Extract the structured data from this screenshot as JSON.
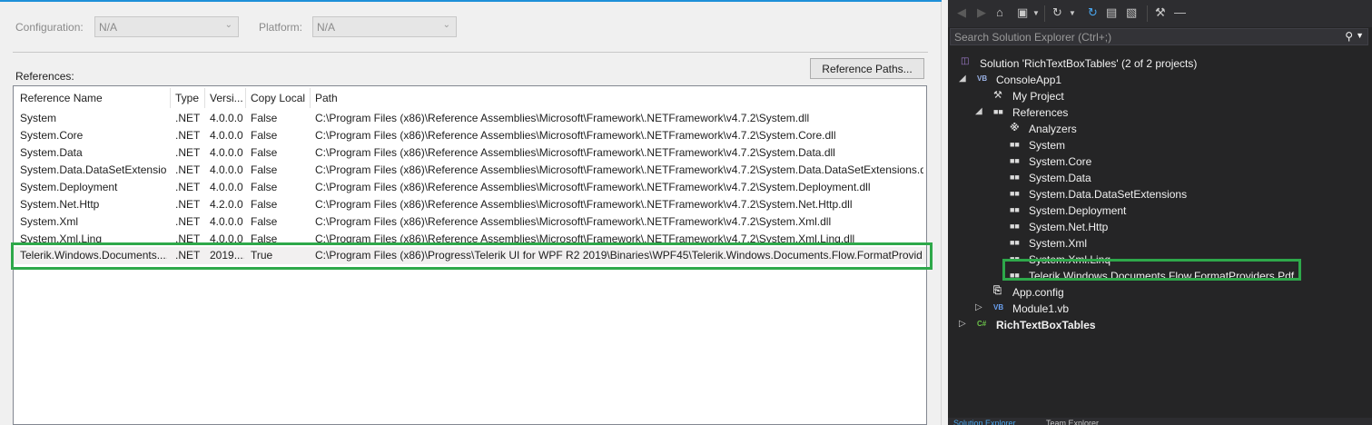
{
  "config": {
    "configuration_label": "Configuration:",
    "configuration_value": "N/A",
    "platform_label": "Platform:",
    "platform_value": "N/A"
  },
  "references": {
    "label": "References:",
    "paths_button": "Reference Paths...",
    "columns": [
      "Reference Name",
      "Type",
      "Versi...",
      "Copy Local",
      "Path"
    ],
    "rows": [
      {
        "name": "System",
        "type": ".NET",
        "version": "4.0.0.0",
        "copy_local": "False",
        "path": "C:\\Program Files (x86)\\Reference Assemblies\\Microsoft\\Framework\\.NETFramework\\v4.7.2\\System.dll"
      },
      {
        "name": "System.Core",
        "type": ".NET",
        "version": "4.0.0.0",
        "copy_local": "False",
        "path": "C:\\Program Files (x86)\\Reference Assemblies\\Microsoft\\Framework\\.NETFramework\\v4.7.2\\System.Core.dll"
      },
      {
        "name": "System.Data",
        "type": ".NET",
        "version": "4.0.0.0",
        "copy_local": "False",
        "path": "C:\\Program Files (x86)\\Reference Assemblies\\Microsoft\\Framework\\.NETFramework\\v4.7.2\\System.Data.dll"
      },
      {
        "name": "System.Data.DataSetExtensions",
        "type": ".NET",
        "version": "4.0.0.0",
        "copy_local": "False",
        "path": "C:\\Program Files (x86)\\Reference Assemblies\\Microsoft\\Framework\\.NETFramework\\v4.7.2\\System.Data.DataSetExtensions.dll"
      },
      {
        "name": "System.Deployment",
        "type": ".NET",
        "version": "4.0.0.0",
        "copy_local": "False",
        "path": "C:\\Program Files (x86)\\Reference Assemblies\\Microsoft\\Framework\\.NETFramework\\v4.7.2\\System.Deployment.dll"
      },
      {
        "name": "System.Net.Http",
        "type": ".NET",
        "version": "4.2.0.0",
        "copy_local": "False",
        "path": "C:\\Program Files (x86)\\Reference Assemblies\\Microsoft\\Framework\\.NETFramework\\v4.7.2\\System.Net.Http.dll"
      },
      {
        "name": "System.Xml",
        "type": ".NET",
        "version": "4.0.0.0",
        "copy_local": "False",
        "path": "C:\\Program Files (x86)\\Reference Assemblies\\Microsoft\\Framework\\.NETFramework\\v4.7.2\\System.Xml.dll"
      },
      {
        "name": "System.Xml.Linq",
        "type": ".NET",
        "version": "4.0.0.0",
        "copy_local": "False",
        "path": "C:\\Program Files (x86)\\Reference Assemblies\\Microsoft\\Framework\\.NETFramework\\v4.7.2\\System.Xml.Linq.dll"
      },
      {
        "name": "Telerik.Windows.Documents....",
        "type": ".NET",
        "version": "2019....",
        "copy_local": "True",
        "path": "C:\\Program Files (x86)\\Progress\\Telerik UI for WPF R2 2019\\Binaries\\WPF45\\Telerik.Windows.Documents.Flow.FormatProvid..."
      }
    ]
  },
  "solution_explorer": {
    "search_placeholder": "Search Solution Explorer (Ctrl+;)",
    "tree": [
      {
        "label": "Solution 'RichTextBoxTables' (2 of 2 projects)",
        "icon": "solution-icon"
      },
      {
        "label": "ConsoleApp1",
        "icon": "vb-project-icon"
      },
      {
        "label": "My Project",
        "icon": "wrench-icon"
      },
      {
        "label": "References",
        "icon": "references-icon"
      },
      {
        "label": "Analyzers",
        "icon": "analyzers-icon"
      },
      {
        "label": "System",
        "icon": "reference-icon"
      },
      {
        "label": "System.Core",
        "icon": "reference-icon"
      },
      {
        "label": "System.Data",
        "icon": "reference-icon"
      },
      {
        "label": "System.Data.DataSetExtensions",
        "icon": "reference-icon"
      },
      {
        "label": "System.Deployment",
        "icon": "reference-icon"
      },
      {
        "label": "System.Net.Http",
        "icon": "reference-icon"
      },
      {
        "label": "System.Xml",
        "icon": "reference-icon"
      },
      {
        "label": "System.Xml.Linq",
        "icon": "reference-icon"
      },
      {
        "label": "Telerik.Windows.Documents.Flow.FormatProviders.Pdf",
        "icon": "reference-icon"
      },
      {
        "label": "App.config",
        "icon": "config-file-icon"
      },
      {
        "label": "Module1.vb",
        "icon": "vb-file-icon"
      },
      {
        "label": "RichTextBoxTables",
        "icon": "csharp-project-icon"
      }
    ],
    "bottom_tabs": [
      "Solution Explorer",
      "Team Explorer"
    ]
  },
  "colors": {
    "highlight_border": "#2ea84a",
    "accent_blue": "#1e90d8",
    "dark_background": "#252526"
  }
}
